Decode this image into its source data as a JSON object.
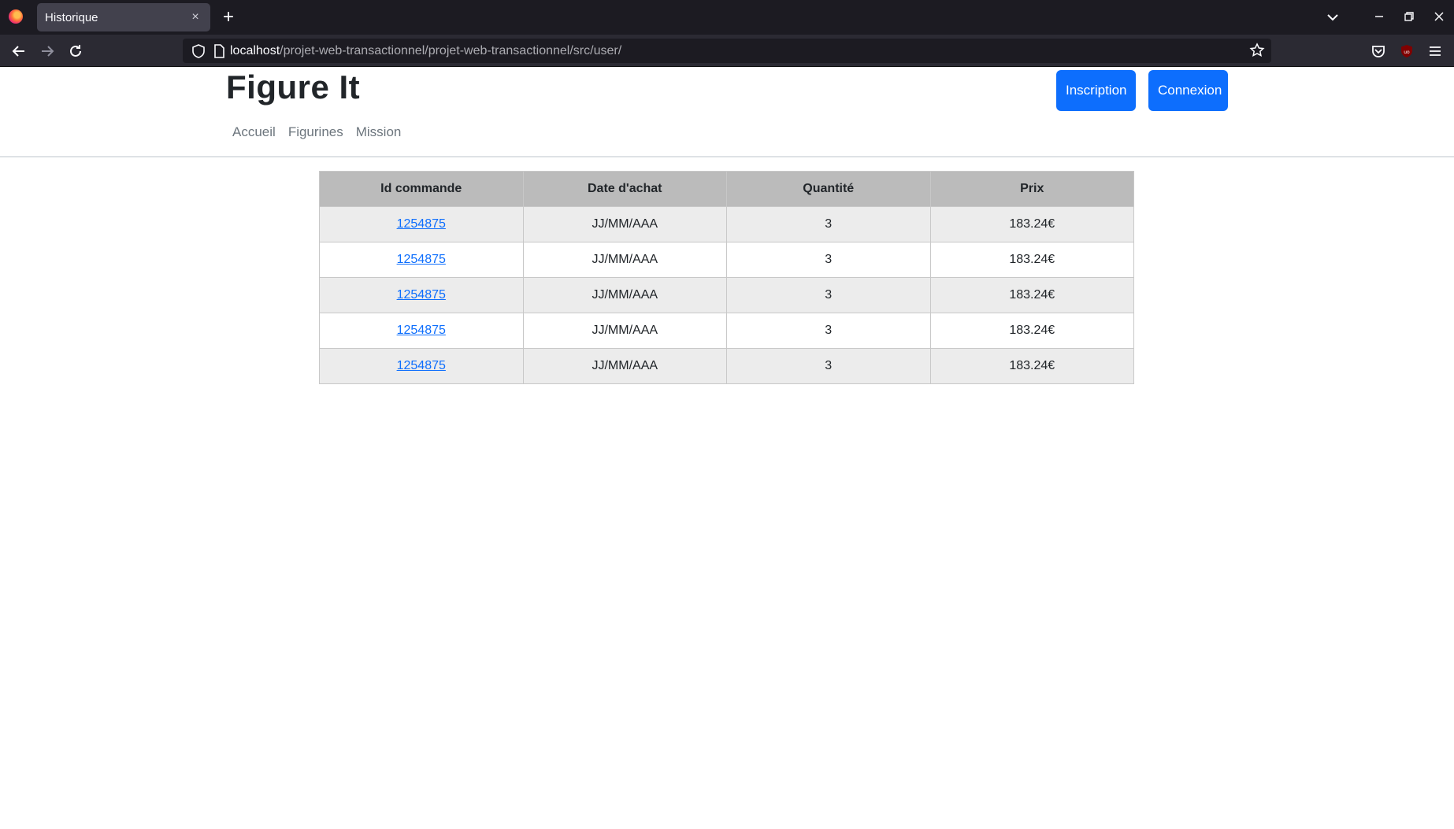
{
  "browser": {
    "tab_title": "Historique",
    "tab_close": "×",
    "new_tab": "+",
    "url_host": "localhost",
    "url_path": "/projet-web-transactionnel/projet-web-transactionnel/src/user/"
  },
  "site": {
    "brand": "Figure It",
    "buttons": {
      "signup": "Inscription",
      "login": "Connexion"
    },
    "nav": [
      "Accueil",
      "Figurines",
      "Mission"
    ]
  },
  "table": {
    "headers": [
      "Id commande",
      "Date d'achat",
      "Quantité",
      "Prix"
    ],
    "rows": [
      {
        "id": "1254875",
        "date": "JJ/MM/AAA",
        "qty": "3",
        "price": "183.24€"
      },
      {
        "id": "1254875",
        "date": "JJ/MM/AAA",
        "qty": "3",
        "price": "183.24€"
      },
      {
        "id": "1254875",
        "date": "JJ/MM/AAA",
        "qty": "3",
        "price": "183.24€"
      },
      {
        "id": "1254875",
        "date": "JJ/MM/AAA",
        "qty": "3",
        "price": "183.24€"
      },
      {
        "id": "1254875",
        "date": "JJ/MM/AAA",
        "qty": "3",
        "price": "183.24€"
      }
    ]
  },
  "colors": {
    "primary": "#0d6efd",
    "header_bg": "#bbbbbb",
    "stripe": "#ececec"
  }
}
